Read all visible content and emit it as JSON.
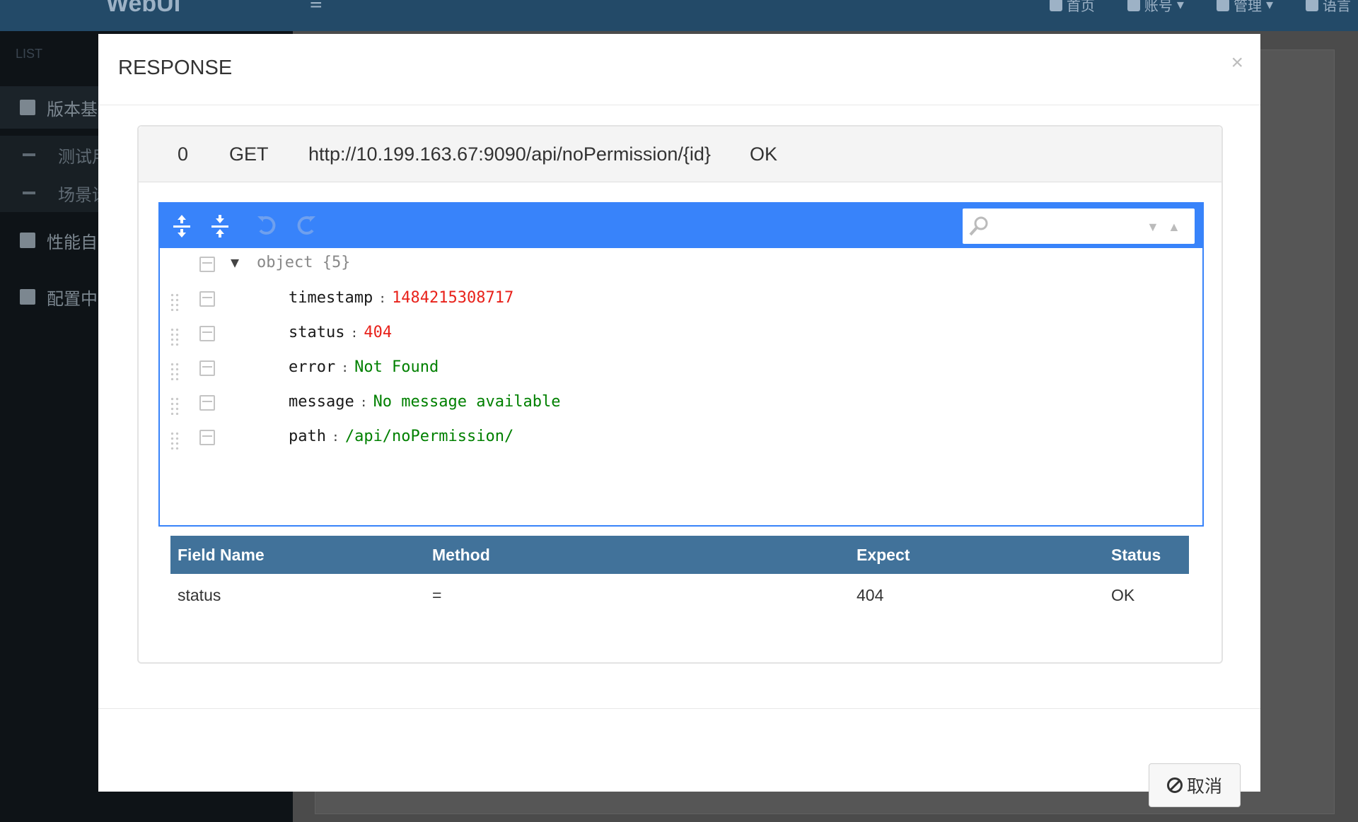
{
  "app": {
    "logo": "WebUI"
  },
  "topnav": [
    {
      "label": "首页",
      "icon": "home-icon"
    },
    {
      "label": "账号",
      "icon": "user-icon"
    },
    {
      "label": "管理",
      "icon": "admin-icon"
    },
    {
      "label": "语言",
      "icon": "language-icon"
    }
  ],
  "sidebar": {
    "header": "LIST",
    "items": [
      {
        "label": "版本基",
        "icon": "flask-icon"
      },
      {
        "label": "测试用",
        "icon": "dash-icon"
      },
      {
        "label": "场景设",
        "icon": "dash-icon"
      },
      {
        "label": "性能自",
        "icon": "hourglass-icon"
      },
      {
        "label": "配置中",
        "icon": "grid-icon"
      }
    ]
  },
  "modal": {
    "title": "RESPONSE",
    "close": "×",
    "request": {
      "index": "0",
      "method": "GET",
      "url": "http://10.199.163.67:9090/api/noPermission/{id}",
      "result": "OK"
    },
    "editor": {
      "search_placeholder": "",
      "root_label": "object {5}",
      "fields": [
        {
          "key": "timestamp",
          "value": "1484215308717",
          "type": "number"
        },
        {
          "key": "status",
          "value": "404",
          "type": "number"
        },
        {
          "key": "error",
          "value": "Not Found",
          "type": "string"
        },
        {
          "key": "message",
          "value": "No message available",
          "type": "string"
        },
        {
          "key": "path",
          "value": "/api/noPermission/",
          "type": "string"
        }
      ]
    },
    "assert_table": {
      "headers": [
        "Field Name",
        "Method",
        "Expect",
        "Status"
      ],
      "rows": [
        [
          "status",
          "=",
          "404",
          "OK"
        ]
      ]
    },
    "cancel_label": "取消"
  }
}
